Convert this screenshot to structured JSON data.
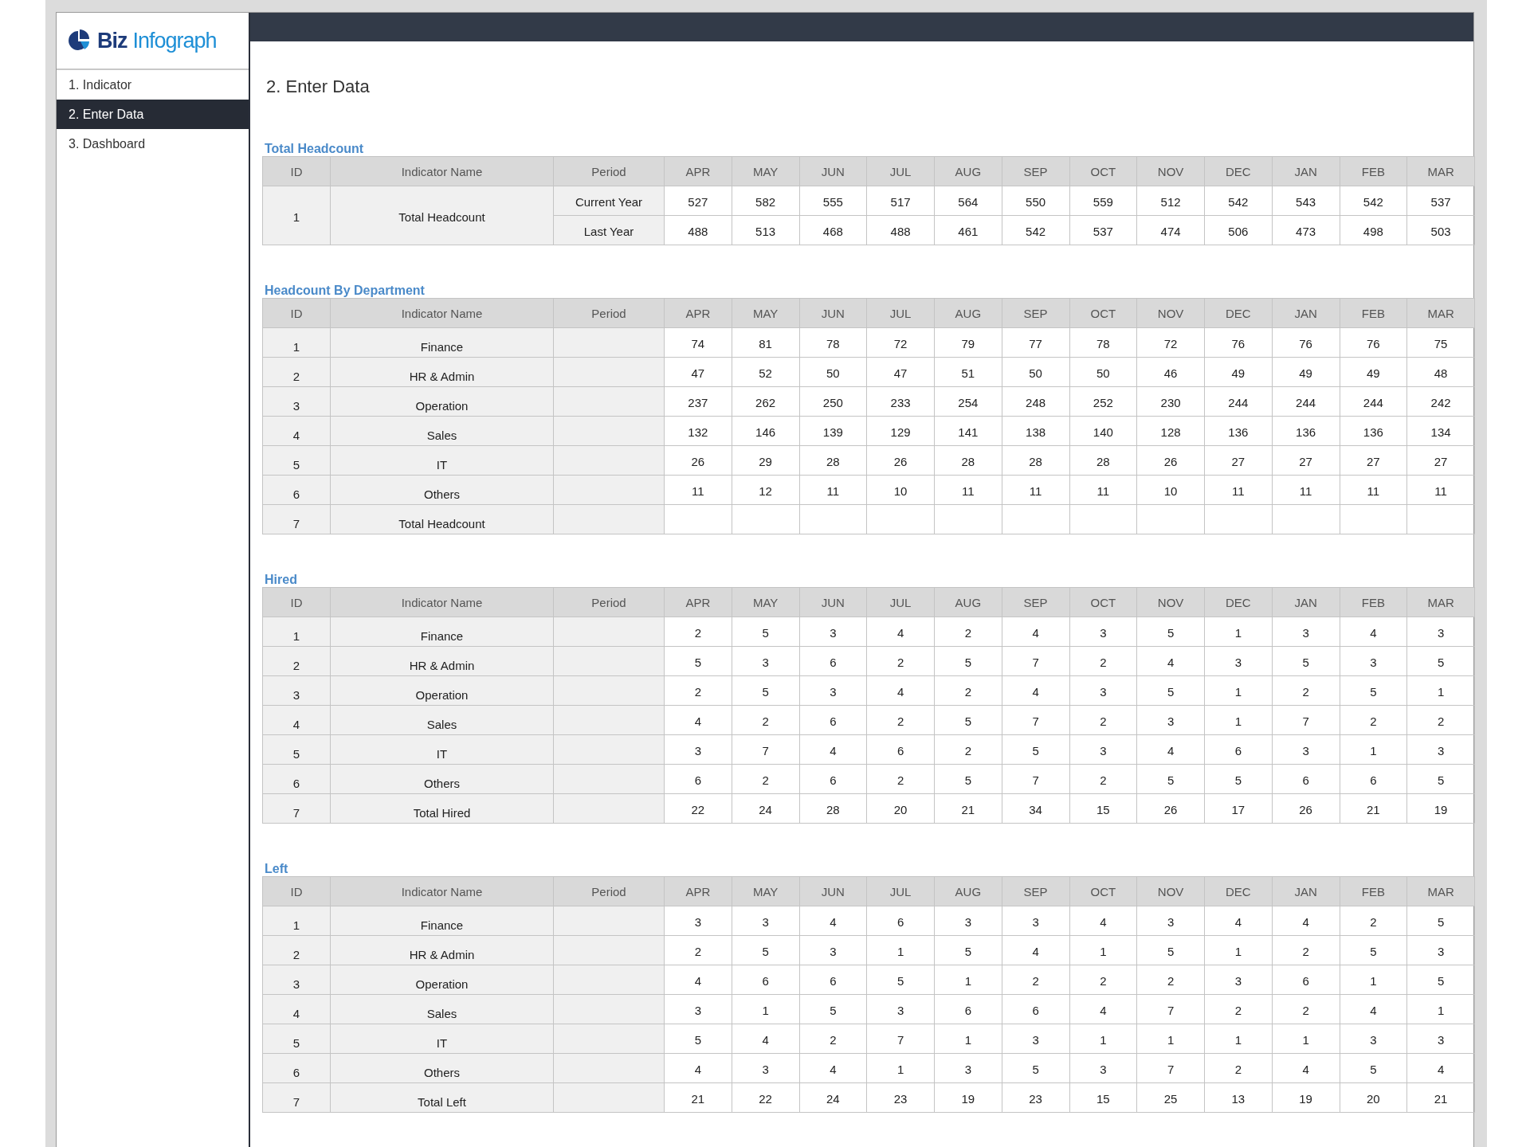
{
  "logo": {
    "word_1": "Biz",
    "word_2": "Infograph"
  },
  "sidebar": {
    "items": [
      {
        "label": "1. Indicator",
        "selected": false
      },
      {
        "label": "2. Enter Data",
        "selected": true
      },
      {
        "label": "3. Dashboard",
        "selected": false
      }
    ]
  },
  "page_title": "2. Enter Data",
  "sections": [
    {
      "title": "Total Headcount",
      "columns": [
        "ID",
        "Indicator Name",
        "Period",
        "APR",
        "MAY",
        "JUN",
        "JUL",
        "AUG",
        "SEP",
        "OCT",
        "NOV",
        "DEC",
        "JAN",
        "FEB",
        "MAR"
      ],
      "rows": [
        {
          "id": "1",
          "name": "Total Headcount",
          "lines": [
            {
              "period": "Current Year",
              "values": [
                "527",
                "582",
                "555",
                "517",
                "564",
                "550",
                "559",
                "512",
                "542",
                "543",
                "542",
                "537"
              ]
            },
            {
              "period": "Last Year",
              "values": [
                "488",
                "513",
                "468",
                "488",
                "461",
                "542",
                "537",
                "474",
                "506",
                "473",
                "498",
                "503"
              ]
            }
          ]
        }
      ]
    },
    {
      "title": "Headcount By Department",
      "columns": [
        "ID",
        "Indicator Name",
        "Period",
        "APR",
        "MAY",
        "JUN",
        "JUL",
        "AUG",
        "SEP",
        "OCT",
        "NOV",
        "DEC",
        "JAN",
        "FEB",
        "MAR"
      ],
      "rows": [
        {
          "id": "1",
          "name": "Finance",
          "lines": [
            {
              "values": [
                "74",
                "81",
                "78",
                "72",
                "79",
                "77",
                "78",
                "72",
                "76",
                "76",
                "76",
                "75"
              ]
            }
          ]
        },
        {
          "id": "2",
          "name": "HR & Admin",
          "lines": [
            {
              "values": [
                "47",
                "52",
                "50",
                "47",
                "51",
                "50",
                "50",
                "46",
                "49",
                "49",
                "49",
                "48"
              ]
            }
          ]
        },
        {
          "id": "3",
          "name": "Operation",
          "lines": [
            {
              "values": [
                "237",
                "262",
                "250",
                "233",
                "254",
                "248",
                "252",
                "230",
                "244",
                "244",
                "244",
                "242"
              ]
            }
          ]
        },
        {
          "id": "4",
          "name": "Sales",
          "lines": [
            {
              "values": [
                "132",
                "146",
                "139",
                "129",
                "141",
                "138",
                "140",
                "128",
                "136",
                "136",
                "136",
                "134"
              ]
            }
          ]
        },
        {
          "id": "5",
          "name": "IT",
          "lines": [
            {
              "values": [
                "26",
                "29",
                "28",
                "26",
                "28",
                "28",
                "28",
                "26",
                "27",
                "27",
                "27",
                "27"
              ]
            }
          ]
        },
        {
          "id": "6",
          "name": "Others",
          "lines": [
            {
              "values": [
                "11",
                "12",
                "11",
                "10",
                "11",
                "11",
                "11",
                "10",
                "11",
                "11",
                "11",
                "11"
              ]
            }
          ]
        },
        {
          "id": "7",
          "name": "Total Headcount"
        }
      ]
    },
    {
      "title": "Hired",
      "columns": [
        "ID",
        "Indicator Name",
        "Period",
        "APR",
        "MAY",
        "JUN",
        "JUL",
        "AUG",
        "SEP",
        "OCT",
        "NOV",
        "DEC",
        "JAN",
        "FEB",
        "MAR"
      ],
      "rows": [
        {
          "id": "1",
          "name": "Finance",
          "lines": [
            {
              "values": [
                "2",
                "5",
                "3",
                "4",
                "2",
                "4",
                "3",
                "5",
                "1",
                "3",
                "4",
                "3"
              ]
            }
          ]
        },
        {
          "id": "2",
          "name": "HR & Admin",
          "lines": [
            {
              "values": [
                "5",
                "3",
                "6",
                "2",
                "5",
                "7",
                "2",
                "4",
                "3",
                "5",
                "3",
                "5"
              ]
            }
          ]
        },
        {
          "id": "3",
          "name": "Operation",
          "lines": [
            {
              "values": [
                "2",
                "5",
                "3",
                "4",
                "2",
                "4",
                "3",
                "5",
                "1",
                "2",
                "5",
                "1"
              ]
            }
          ]
        },
        {
          "id": "4",
          "name": "Sales",
          "lines": [
            {
              "values": [
                "4",
                "2",
                "6",
                "2",
                "5",
                "7",
                "2",
                "3",
                "1",
                "7",
                "2",
                "2"
              ]
            }
          ]
        },
        {
          "id": "5",
          "name": "IT",
          "lines": [
            {
              "values": [
                "3",
                "7",
                "4",
                "6",
                "2",
                "5",
                "3",
                "4",
                "6",
                "3",
                "1",
                "3"
              ]
            }
          ]
        },
        {
          "id": "6",
          "name": "Others",
          "lines": [
            {
              "values": [
                "6",
                "2",
                "6",
                "2",
                "5",
                "7",
                "2",
                "5",
                "5",
                "6",
                "6",
                "5"
              ]
            }
          ]
        },
        {
          "id": "7",
          "name": "Total Hired",
          "lines": [
            {
              "values": [
                "22",
                "24",
                "28",
                "20",
                "21",
                "34",
                "15",
                "26",
                "17",
                "26",
                "21",
                "19"
              ]
            }
          ]
        }
      ]
    },
    {
      "title": "Left",
      "columns": [
        "ID",
        "Indicator Name",
        "Period",
        "APR",
        "MAY",
        "JUN",
        "JUL",
        "AUG",
        "SEP",
        "OCT",
        "NOV",
        "DEC",
        "JAN",
        "FEB",
        "MAR"
      ],
      "rows": [
        {
          "id": "1",
          "name": "Finance",
          "lines": [
            {
              "values": [
                "3",
                "3",
                "4",
                "6",
                "3",
                "3",
                "4",
                "3",
                "4",
                "4",
                "2",
                "5"
              ]
            }
          ]
        },
        {
          "id": "2",
          "name": "HR & Admin",
          "lines": [
            {
              "values": [
                "2",
                "5",
                "3",
                "1",
                "5",
                "4",
                "1",
                "5",
                "1",
                "2",
                "5",
                "3"
              ]
            }
          ]
        },
        {
          "id": "3",
          "name": "Operation",
          "lines": [
            {
              "values": [
                "4",
                "6",
                "6",
                "5",
                "1",
                "2",
                "2",
                "2",
                "3",
                "6",
                "1",
                "5"
              ]
            }
          ]
        },
        {
          "id": "4",
          "name": "Sales",
          "lines": [
            {
              "values": [
                "3",
                "1",
                "5",
                "3",
                "6",
                "6",
                "4",
                "7",
                "2",
                "2",
                "4",
                "1"
              ]
            }
          ]
        },
        {
          "id": "5",
          "name": "IT",
          "lines": [
            {
              "values": [
                "5",
                "4",
                "2",
                "7",
                "1",
                "3",
                "1",
                "1",
                "1",
                "1",
                "3",
                "3"
              ]
            }
          ]
        },
        {
          "id": "6",
          "name": "Others",
          "lines": [
            {
              "values": [
                "4",
                "3",
                "4",
                "1",
                "3",
                "5",
                "3",
                "7",
                "2",
                "4",
                "5",
                "4"
              ]
            }
          ]
        },
        {
          "id": "7",
          "name": "Total Left",
          "lines": [
            {
              "values": [
                "21",
                "22",
                "24",
                "23",
                "19",
                "23",
                "15",
                "25",
                "13",
                "19",
                "20",
                "21"
              ]
            }
          ]
        }
      ]
    }
  ]
}
